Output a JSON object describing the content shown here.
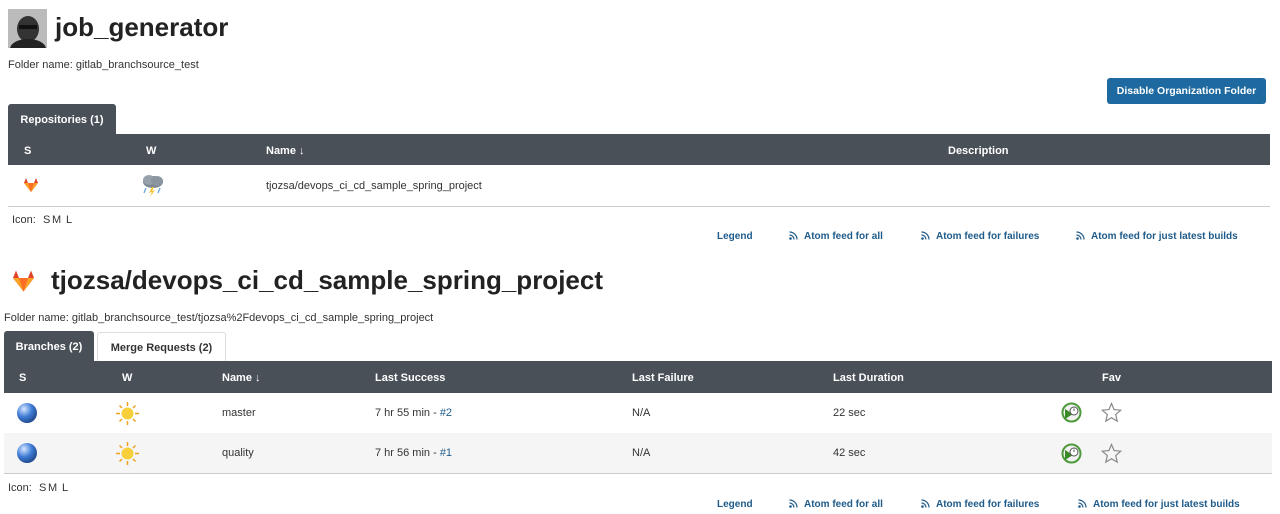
{
  "org": {
    "title": "job_generator",
    "folder_name": "Folder name: gitlab_branchsource_test",
    "disable_button": "Disable Organization Folder",
    "tab": "Repositories (1)",
    "columns": [
      "S",
      "W",
      "Name ↓",
      "Description"
    ],
    "rows": [
      {
        "status_icon": "gitlab-icon",
        "weather_icon": "storm-icon",
        "name": "tjozsa/devops_ci_cd_sample_spring_project",
        "description": ""
      }
    ],
    "icon_label": "Icon:",
    "icon_sizes": [
      "S",
      "M",
      "L"
    ],
    "footer": {
      "legend": "Legend",
      "atom_all": "Atom feed for all",
      "atom_failures": "Atom feed for failures",
      "atom_latest": "Atom feed for just latest builds"
    }
  },
  "project": {
    "title": "tjozsa/devops_ci_cd_sample_spring_project",
    "folder_name": "Folder name: gitlab_branchsource_test/tjozsa%2Fdevops_ci_cd_sample_spring_project",
    "tabs": [
      "Branches (2)",
      "Merge Requests (2)"
    ],
    "columns": [
      "S",
      "W",
      "Name ↓",
      "Last Success",
      "Last Failure",
      "Last Duration",
      "Fav"
    ],
    "rows": [
      {
        "name": "master",
        "last_success": "7 hr 55 min - ",
        "success_build": "#2",
        "last_failure": "N/A",
        "duration": "22 sec"
      },
      {
        "name": "quality",
        "last_success": "7 hr 56 min - ",
        "success_build": "#1",
        "last_failure": "N/A",
        "duration": "42 sec"
      }
    ],
    "icon_label": "Icon:",
    "icon_sizes": [
      "S",
      "M",
      "L"
    ],
    "footer": {
      "legend": "Legend",
      "atom_all": "Atom feed for all",
      "atom_failures": "Atom feed for failures",
      "atom_latest": "Atom feed for just latest builds"
    }
  },
  "colors": {
    "header_bg": "#4a5058",
    "link": "#1f5b8a",
    "button": "#1e6aa0",
    "gitlab_orange": "#e2432a"
  }
}
